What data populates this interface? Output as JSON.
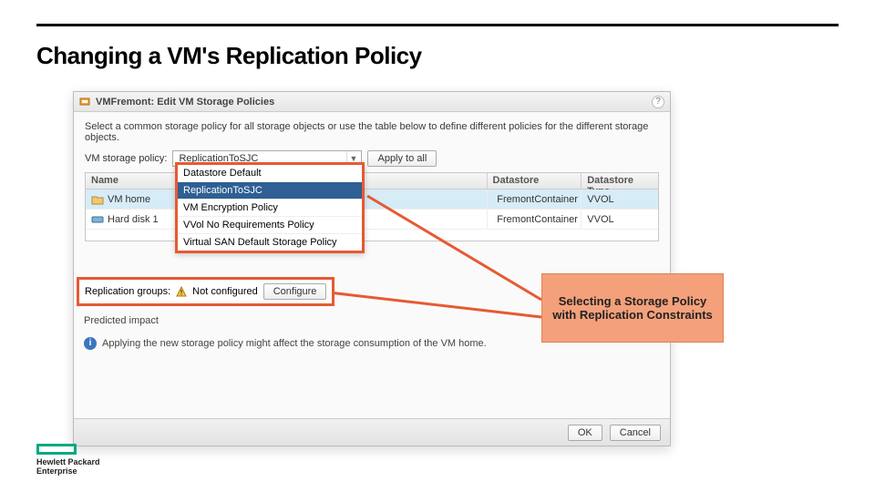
{
  "slide_title": "Changing a VM's Replication Policy",
  "dialog": {
    "title": "VMFremont: Edit VM Storage Policies",
    "instructions": "Select a common storage policy for all storage objects or use the table below to define different policies for the different storage objects.",
    "policy_label": "VM storage policy:",
    "policy_selected": "ReplicationToSJC",
    "apply_all_label": "Apply to all",
    "columns": {
      "name": "Name",
      "datastore": "Datastore",
      "dstype": "Datastore Type"
    },
    "rows": [
      {
        "name": "VM home",
        "datastore": "FremontContainer",
        "dstype": "VVOL"
      },
      {
        "name": "Hard disk 1",
        "datastore": "FremontContainer",
        "dstype": "VVOL"
      }
    ],
    "dropdown_options": [
      {
        "label": "Datastore Default",
        "selected": false
      },
      {
        "label": "ReplicationToSJC",
        "selected": true
      },
      {
        "label": "VM Encryption Policy",
        "selected": false
      },
      {
        "label": "VVol No Requirements Policy",
        "selected": false
      },
      {
        "label": "Virtual SAN Default Storage Policy",
        "selected": false
      }
    ],
    "replication_groups": {
      "label": "Replication groups:",
      "status": "Not configured",
      "button": "Configure"
    },
    "predicted_label": "Predicted impact",
    "impact_text": "Applying the new storage policy might affect the storage consumption of the VM home.",
    "ok": "OK",
    "cancel": "Cancel"
  },
  "callout_text": "Selecting a Storage Policy with Replication Constraints",
  "logo": {
    "line1": "Hewlett Packard",
    "line2": "Enterprise"
  }
}
